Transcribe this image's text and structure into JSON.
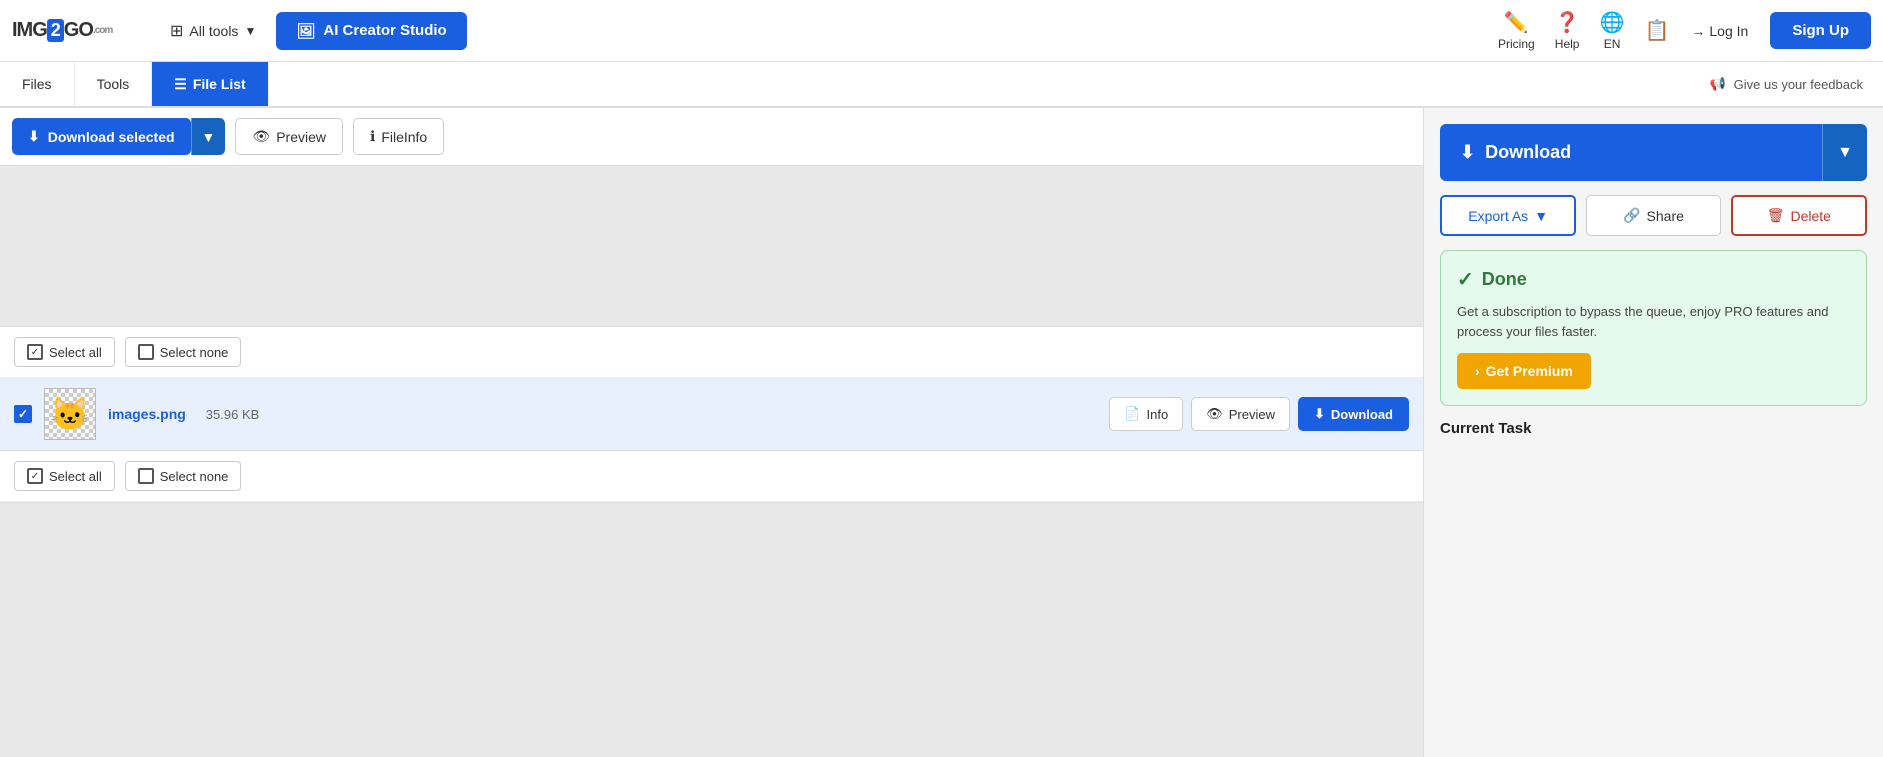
{
  "logo": {
    "img": "IMG",
    "two": "2",
    "go": "GO",
    "com": ".com"
  },
  "topnav": {
    "all_tools": "All tools",
    "ai_creator_studio": "AI Creator Studio",
    "pricing": "Pricing",
    "help": "Help",
    "lang": "EN",
    "notifications_icon": "clipboard-icon",
    "login": "Log In",
    "signup": "Sign Up"
  },
  "subnav": {
    "tabs": [
      {
        "id": "files",
        "label": "Files",
        "active": false
      },
      {
        "id": "tools",
        "label": "Tools",
        "active": false
      },
      {
        "id": "file-list",
        "label": "File List",
        "active": true
      }
    ],
    "feedback": "Give us your feedback"
  },
  "toolbar": {
    "download_selected": "Download selected",
    "preview": "Preview",
    "file_info": "FileInfo"
  },
  "file_list": {
    "select_all_top": "Select all",
    "select_none_top": "Select none",
    "file": {
      "name": "images.png",
      "size": "35.96 KB",
      "checked": true
    },
    "file_info_btn": "Info",
    "file_preview_btn": "Preview",
    "file_download_btn": "Download",
    "select_all_bottom": "Select all",
    "select_none_bottom": "Select none"
  },
  "right_panel": {
    "download_btn": "Download",
    "export_as": "Export As",
    "share": "Share",
    "delete": "Delete",
    "done_title": "Done",
    "done_text": "Get a subscription to bypass the queue, enjoy PRO features and process your files faster.",
    "get_premium": "Get Premium",
    "current_task": "Current Task"
  }
}
